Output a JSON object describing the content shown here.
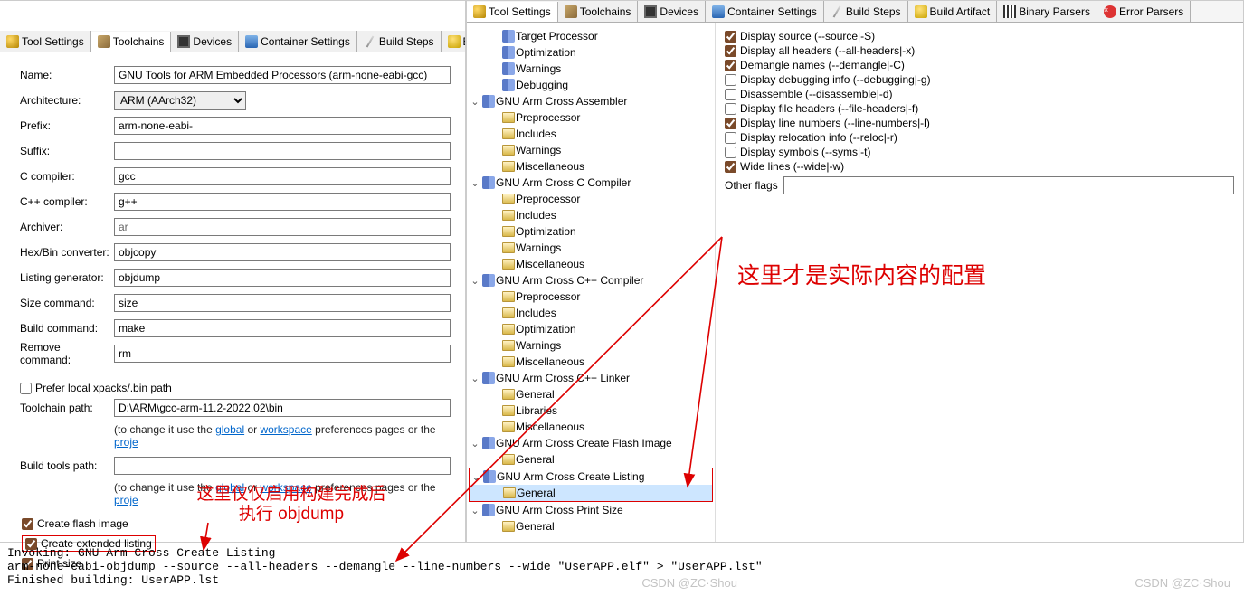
{
  "left": {
    "tabs": [
      "Tool Settings",
      "Toolchains",
      "Devices",
      "Container Settings",
      "Build Steps",
      "Bui"
    ],
    "active_tab": 1,
    "fields": {
      "name_lbl": "Name:",
      "name": "GNU Tools for ARM Embedded Processors (arm-none-eabi-gcc)",
      "arch_lbl": "Architecture:",
      "arch": "ARM (AArch32)",
      "prefix_lbl": "Prefix:",
      "prefix": "arm-none-eabi-",
      "suffix_lbl": "Suffix:",
      "suffix": "",
      "cc_lbl": "C compiler:",
      "cc": "gcc",
      "cxx_lbl": "C++ compiler:",
      "cxx": "g++",
      "ar_lbl": "Archiver:",
      "ar": "ar",
      "hex_lbl": "Hex/Bin converter:",
      "hex": "objcopy",
      "lst_lbl": "Listing generator:",
      "lst": "objdump",
      "size_lbl": "Size command:",
      "size": "size",
      "build_lbl": "Build command:",
      "build": "make",
      "rm_lbl": "Remove command:",
      "rm": "rm"
    },
    "prefer_local": "Prefer local xpacks/.bin path",
    "toolchain_path_lbl": "Toolchain path:",
    "toolchain_path": "D:\\ARM\\gcc-arm-11.2-2022.02\\bin",
    "hint_pre": "(to change it use the ",
    "hint_global": "global",
    "hint_or": " or ",
    "hint_ws": "workspace",
    "hint_post": " preferences pages or the ",
    "hint_proj": "proje",
    "build_tools_lbl": "Build tools path:",
    "opts": {
      "flash": {
        "label": "Create flash image",
        "checked": true
      },
      "listing": {
        "label": "Create extended listing",
        "checked": true
      },
      "psize": {
        "label": "Print size",
        "checked": true
      }
    }
  },
  "right": {
    "tabs": [
      "Tool Settings",
      "Toolchains",
      "Devices",
      "Container Settings",
      "Build Steps",
      "Build Artifact",
      "Binary Parsers",
      "Error Parsers"
    ],
    "active_tab": 0,
    "tree": [
      {
        "d": 1,
        "i": "t",
        "l": "Target Processor"
      },
      {
        "d": 1,
        "i": "t",
        "l": "Optimization"
      },
      {
        "d": 1,
        "i": "t",
        "l": "Warnings"
      },
      {
        "d": 1,
        "i": "t",
        "l": "Debugging"
      },
      {
        "d": 0,
        "tw": "v",
        "i": "t",
        "l": "GNU Arm Cross Assembler"
      },
      {
        "d": 1,
        "i": "f",
        "l": "Preprocessor"
      },
      {
        "d": 1,
        "i": "f",
        "l": "Includes"
      },
      {
        "d": 1,
        "i": "f",
        "l": "Warnings"
      },
      {
        "d": 1,
        "i": "f",
        "l": "Miscellaneous"
      },
      {
        "d": 0,
        "tw": "v",
        "i": "t",
        "l": "GNU Arm Cross C Compiler"
      },
      {
        "d": 1,
        "i": "f",
        "l": "Preprocessor"
      },
      {
        "d": 1,
        "i": "f",
        "l": "Includes"
      },
      {
        "d": 1,
        "i": "f",
        "l": "Optimization"
      },
      {
        "d": 1,
        "i": "f",
        "l": "Warnings"
      },
      {
        "d": 1,
        "i": "f",
        "l": "Miscellaneous"
      },
      {
        "d": 0,
        "tw": "v",
        "i": "t",
        "l": "GNU Arm Cross C++ Compiler"
      },
      {
        "d": 1,
        "i": "f",
        "l": "Preprocessor"
      },
      {
        "d": 1,
        "i": "f",
        "l": "Includes"
      },
      {
        "d": 1,
        "i": "f",
        "l": "Optimization"
      },
      {
        "d": 1,
        "i": "f",
        "l": "Warnings"
      },
      {
        "d": 1,
        "i": "f",
        "l": "Miscellaneous"
      },
      {
        "d": 0,
        "tw": "v",
        "i": "t",
        "l": "GNU Arm Cross C++ Linker"
      },
      {
        "d": 1,
        "i": "f",
        "l": "General"
      },
      {
        "d": 1,
        "i": "f",
        "l": "Libraries"
      },
      {
        "d": 1,
        "i": "f",
        "l": "Miscellaneous"
      },
      {
        "d": 0,
        "tw": "v",
        "i": "t",
        "l": "GNU Arm Cross Create Flash Image"
      },
      {
        "d": 1,
        "i": "f",
        "l": "General"
      },
      {
        "d": 0,
        "tw": "v",
        "i": "t",
        "l": "GNU Arm Cross Create Listing",
        "hl": true
      },
      {
        "d": 1,
        "i": "f",
        "l": "General",
        "hl": true,
        "sel": true
      },
      {
        "d": 0,
        "tw": "v",
        "i": "t",
        "l": "GNU Arm Cross Print Size"
      },
      {
        "d": 1,
        "i": "f",
        "l": "General"
      }
    ],
    "opts": [
      {
        "label": "Display source (--source|-S)",
        "checked": true
      },
      {
        "label": "Display all headers (--all-headers|-x)",
        "checked": true
      },
      {
        "label": "Demangle names (--demangle|-C)",
        "checked": true
      },
      {
        "label": "Display debugging info (--debugging|-g)",
        "checked": false
      },
      {
        "label": "Disassemble (--disassemble|-d)",
        "checked": false
      },
      {
        "label": "Display file headers (--file-headers|-f)",
        "checked": false
      },
      {
        "label": "Display line numbers (--line-numbers|-l)",
        "checked": true
      },
      {
        "label": "Display relocation info (--reloc|-r)",
        "checked": false
      },
      {
        "label": "Display symbols (--syms|-t)",
        "checked": false
      },
      {
        "label": "Wide lines (--wide|-w)",
        "checked": true
      }
    ],
    "other_flags_lbl": "Other flags"
  },
  "annot": {
    "left1": "这里仅仅启用构建完成后",
    "left2": "执行 objdump",
    "right": "这里才是实际内容的配置"
  },
  "console": "Invoking: GNU Arm Cross Create Listing\narm-none-eabi-objdump --source --all-headers --demangle --line-numbers --wide \"UserAPP.elf\" > \"UserAPP.lst\"\nFinished building: UserAPP.lst",
  "watermark": "CSDN @ZC·Shou",
  "tab_icons": [
    "tool",
    "chain",
    "chip",
    "cyl",
    "wand",
    "gold",
    "bin",
    "red"
  ]
}
